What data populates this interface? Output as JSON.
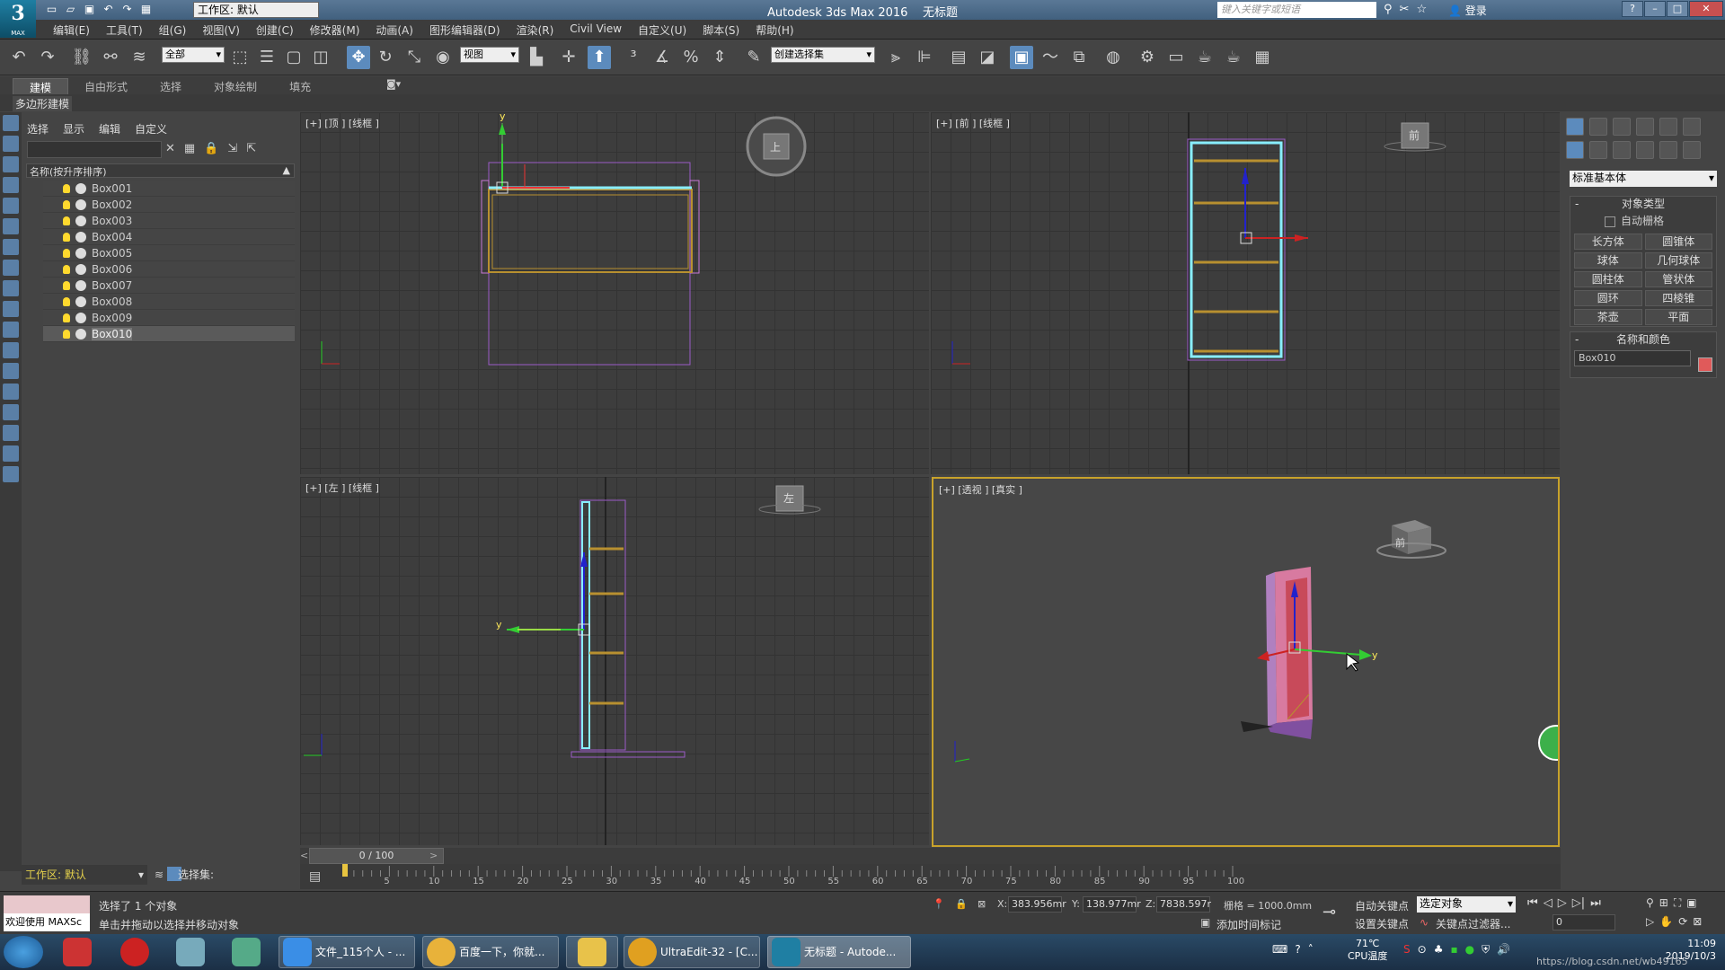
{
  "app": {
    "title": "Autodesk 3ds Max 2016",
    "doc": "无标题",
    "logo_sub": "MAX",
    "workspace": "工作区: 默认",
    "search_placeholder": "键入关键字或短语",
    "login": "登录"
  },
  "menu": [
    "编辑(E)",
    "工具(T)",
    "组(G)",
    "视图(V)",
    "创建(C)",
    "修改器(M)",
    "动画(A)",
    "图形编辑器(D)",
    "渲染(R)",
    "Civil View",
    "自定义(U)",
    "脚本(S)",
    "帮助(H)"
  ],
  "toolbar": {
    "filter": "全部",
    "refcoord": "视图",
    "selset": "创建选择集"
  },
  "ribbon": {
    "tabs": [
      "建模",
      "自由形式",
      "选择",
      "对象绘制",
      "填充"
    ],
    "active_tab": "建模",
    "sub": "多边形建模"
  },
  "scene_explorer": {
    "menu": [
      "选择",
      "显示",
      "编辑",
      "自定义"
    ],
    "header": "名称(按升序排序)",
    "items": [
      "Box001",
      "Box002",
      "Box003",
      "Box004",
      "Box005",
      "Box006",
      "Box007",
      "Box008",
      "Box009",
      "Box010"
    ],
    "selected": "Box010",
    "workspace": "工作区: 默认",
    "selset_label": "选择集:"
  },
  "viewports": {
    "top": "[+] [顶 ] [线框 ]",
    "front": "[+] [前 ] [线框 ]",
    "left": "[+] [左 ] [线框 ]",
    "persp": "[+] [透视 ] [真实 ]",
    "cube_top": "上",
    "cube_front": "前",
    "cube_left": "左",
    "cube_persp": "前"
  },
  "command_panel": {
    "category": "标准基本体",
    "object_type_title": "对象类型",
    "autogrid": "自动栅格",
    "object_types": [
      "长方体",
      "圆锥体",
      "球体",
      "几何球体",
      "圆柱体",
      "管状体",
      "圆环",
      "四棱锥",
      "茶壶",
      "平面"
    ],
    "name_color_title": "名称和颜色",
    "object_name": "Box010",
    "object_color": "#e05a5a"
  },
  "timeline": {
    "slider": "0 / 100",
    "ticks": [
      "5",
      "10",
      "15",
      "20",
      "25",
      "30",
      "35",
      "40",
      "45",
      "50",
      "55",
      "60",
      "65",
      "70",
      "75",
      "80",
      "85",
      "90",
      "95",
      "100"
    ]
  },
  "status": {
    "welcome": "欢迎使用 MAXSc",
    "selected_msg": "选择了 1 个对象",
    "prompt": "单击并拖动以选择并移动对象",
    "x_label": "X:",
    "x": "383.956mr",
    "y_label": "Y:",
    "y": "138.977mr",
    "z_label": "Z:",
    "z": "7838.597r",
    "grid": "栅格 = 1000.0mm",
    "add_time_tag": "添加时间标记",
    "auto_key": "自动关键点",
    "set_key": "设置关键点",
    "key_mode": "选定对象",
    "key_filters": "关键点过滤器...",
    "frame": "0"
  },
  "taskbar": {
    "items": [
      "文件_115个人 - ...",
      "百度一下，你就...",
      "",
      "UltraEdit-32 - [C...",
      "无标题 - Autode..."
    ],
    "temp": "71℃",
    "temp_label": "CPU温度",
    "time": "11:09",
    "date": "2019/10/3",
    "watermark": "https://blog.csdn.net/wb49165"
  }
}
